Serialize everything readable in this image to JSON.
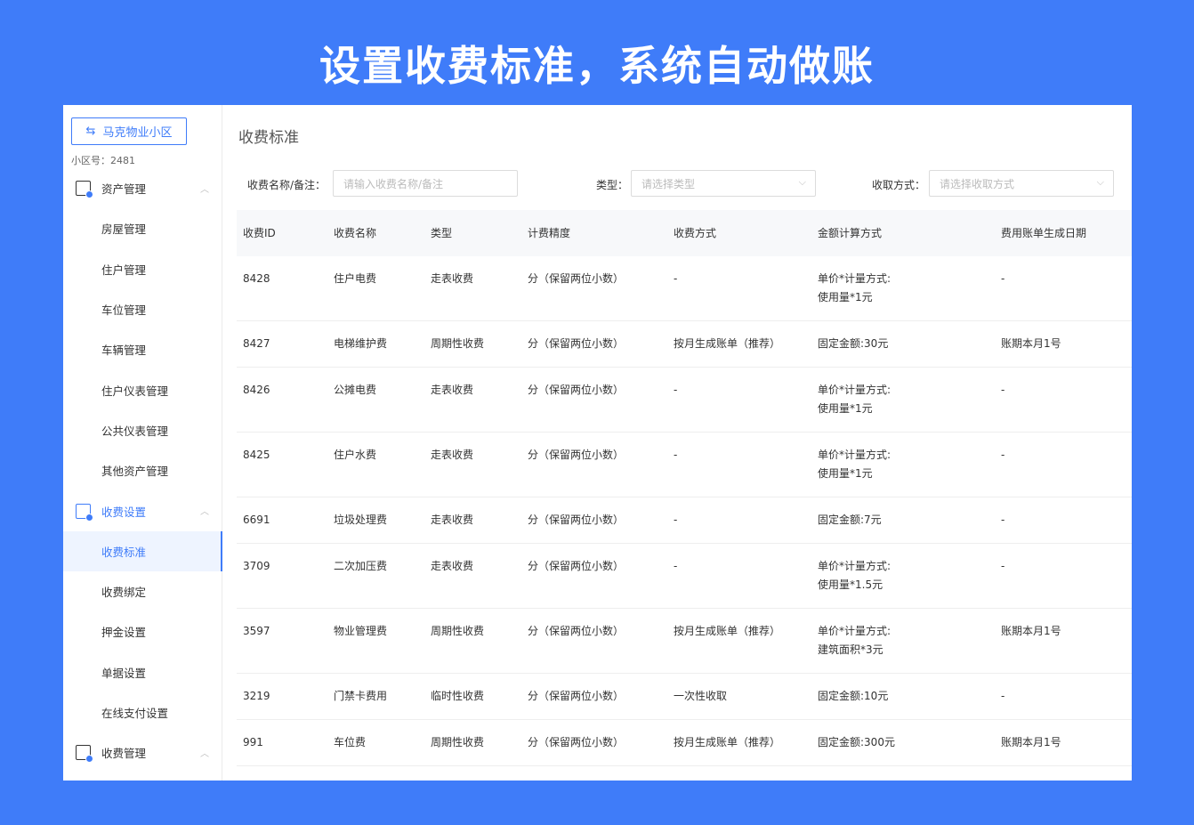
{
  "headline": "设置收费标准，系统自动做账",
  "sidebar": {
    "community_button": "马克物业小区",
    "community_no": "小区号：2481",
    "groups": [
      {
        "label": "资产管理",
        "items": [
          "房屋管理",
          "住户管理",
          "车位管理",
          "车辆管理",
          "住户仪表管理",
          "公共仪表管理",
          "其他资产管理"
        ]
      },
      {
        "label": "收费设置",
        "items": [
          "收费标准",
          "收费绑定",
          "押金设置",
          "单据设置",
          "在线支付设置"
        ]
      },
      {
        "label": "收费管理",
        "items": []
      }
    ],
    "active_item": "收费标准",
    "accent": "#3f7cf9"
  },
  "main": {
    "title": "收费标准",
    "filters": {
      "name_label": "收费名称/备注：",
      "name_placeholder": "请输入收费名称/备注",
      "type_label": "类型：",
      "type_placeholder": "请选择类型",
      "method_label": "收取方式：",
      "method_placeholder": "请选择收取方式"
    },
    "table": {
      "columns": [
        "收费ID",
        "收费名称",
        "类型",
        "计费精度",
        "收费方式",
        "金额计算方式",
        "费用账单生成日期"
      ],
      "rows": [
        {
          "id": "8428",
          "name": "住户电费",
          "type": "走表收费",
          "precision": "分（保留两位小数）",
          "method": "-",
          "amount": [
            "单价*计量方式:",
            "使用量*1元"
          ],
          "date": "-"
        },
        {
          "id": "8427",
          "name": "电梯维护费",
          "type": "周期性收费",
          "precision": "分（保留两位小数）",
          "method": "按月生成账单（推荐）",
          "amount": [
            "固定金额:30元"
          ],
          "date": "账期本月1号"
        },
        {
          "id": "8426",
          "name": "公摊电费",
          "type": "走表收费",
          "precision": "分（保留两位小数）",
          "method": "-",
          "amount": [
            "单价*计量方式:",
            "使用量*1元"
          ],
          "date": "-"
        },
        {
          "id": "8425",
          "name": "住户水费",
          "type": "走表收费",
          "precision": "分（保留两位小数）",
          "method": "-",
          "amount": [
            "单价*计量方式:",
            "使用量*1元"
          ],
          "date": "-"
        },
        {
          "id": "6691",
          "name": "垃圾处理费",
          "type": "走表收费",
          "precision": "分（保留两位小数）",
          "method": "-",
          "amount": [
            "固定金额:7元"
          ],
          "date": "-"
        },
        {
          "id": "3709",
          "name": "二次加压费",
          "type": "走表收费",
          "precision": "分（保留两位小数）",
          "method": "-",
          "amount": [
            "单价*计量方式:",
            "使用量*1.5元"
          ],
          "date": "-"
        },
        {
          "id": "3597",
          "name": "物业管理费",
          "type": "周期性收费",
          "precision": "分（保留两位小数）",
          "method": "按月生成账单（推荐）",
          "amount": [
            "单价*计量方式:",
            "建筑面积*3元"
          ],
          "date": "账期本月1号"
        },
        {
          "id": "3219",
          "name": "门禁卡费用",
          "type": "临时性收费",
          "precision": "分（保留两位小数）",
          "method": "一次性收取",
          "amount": [
            "固定金额:10元"
          ],
          "date": "-"
        },
        {
          "id": "991",
          "name": "车位费",
          "type": "周期性收费",
          "precision": "分（保留两位小数）",
          "method": "按月生成账单（推荐）",
          "amount": [
            "固定金额:300元"
          ],
          "date": "账期本月1号"
        }
      ]
    }
  }
}
